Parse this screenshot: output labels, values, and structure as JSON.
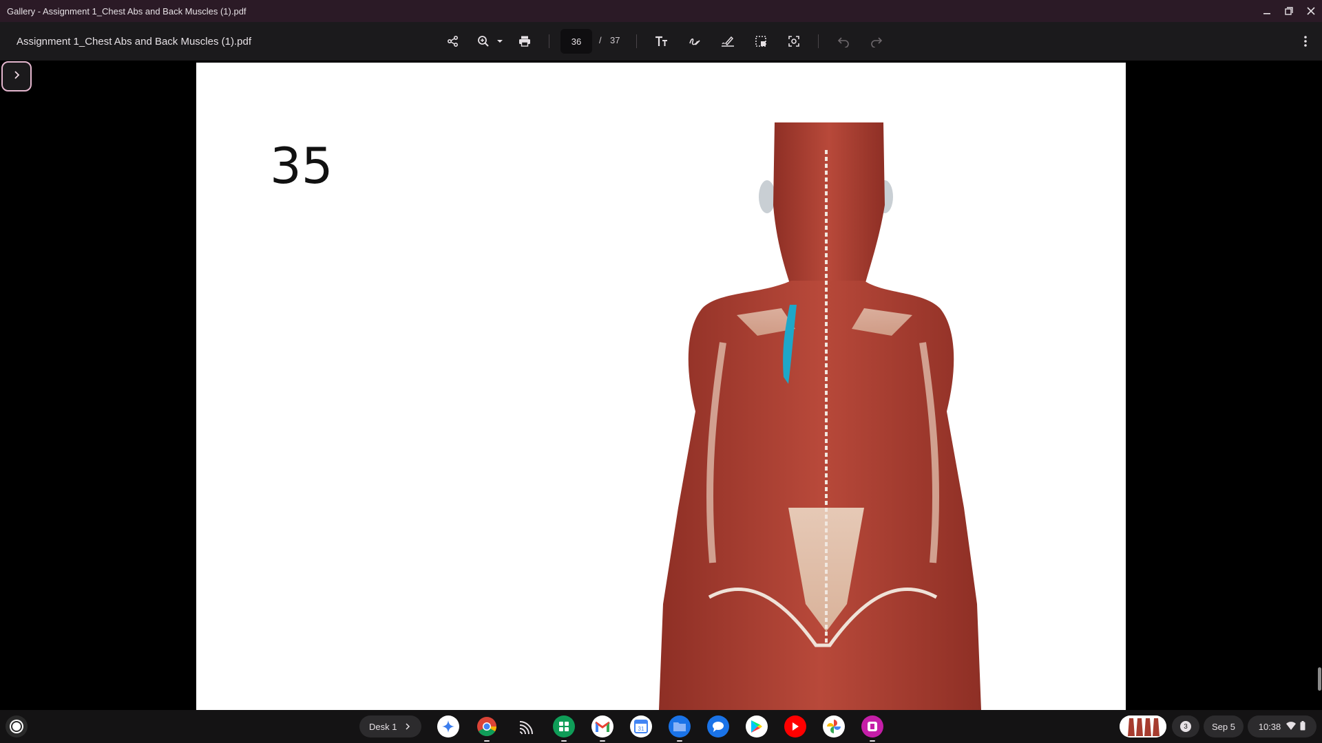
{
  "window": {
    "title": "Gallery - Assignment 1_Chest Abs and Back Muscles (1).pdf",
    "controls": [
      "minimize-icon",
      "restore-icon",
      "close-icon"
    ]
  },
  "toolbar": {
    "doc_name": "Assignment 1_Chest Abs and Back Muscles (1).pdf",
    "current_page": "36",
    "page_separator": "/",
    "total_pages": "37",
    "icons": [
      "share-icon",
      "zoom-in-icon",
      "zoom-dropdown-icon",
      "print-icon",
      "text-annotation-icon",
      "draw-icon",
      "signature-icon",
      "select-area-icon",
      "screenshot-icon",
      "undo-icon",
      "redo-icon",
      "more-options-icon"
    ]
  },
  "sidebar": {
    "toggle_icon": "chevron-right-icon"
  },
  "document": {
    "slide_number": "35",
    "image_semantic": "posterior-back-muscles-anatomy-with-highlighted-rhomboid"
  },
  "shelf": {
    "desk_label": "Desk 1",
    "apps": [
      "gemini-icon",
      "chrome-icon",
      "cast-icon",
      "classroom-icon",
      "gmail-icon",
      "calendar-icon",
      "files-icon",
      "messages-icon",
      "play-store-icon",
      "youtube-icon",
      "photos-icon",
      "gallery-icon"
    ],
    "notification_count": "3",
    "date": "Sep 5",
    "time": "10:38"
  },
  "colors": {
    "title_bar": "#2b1a26",
    "toolbar": "#1b1a1c",
    "accent": "#e5b7cf",
    "highlight_muscle": "#1ea7c9"
  }
}
